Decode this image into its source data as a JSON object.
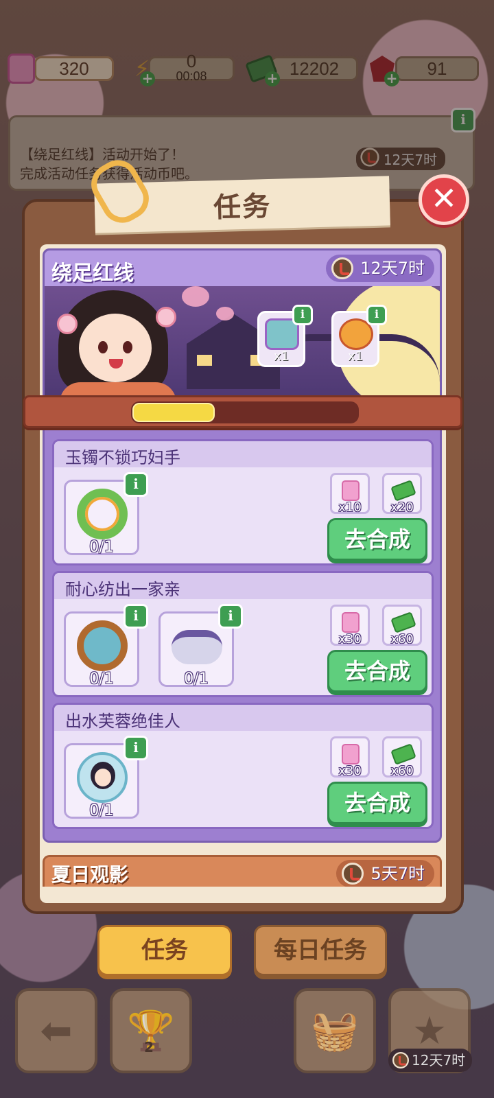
{
  "currency": {
    "tickets": "320",
    "energy": "0",
    "energy_timer": "00:08",
    "cash": "12202",
    "gems": "91"
  },
  "notice": {
    "line1": "【绕足红线】活动开始了！",
    "line2": "完成活动任务获得活动币吧。",
    "timer": "12天7时"
  },
  "dialog": {
    "title": "任务",
    "close_icon": "close-icon"
  },
  "event": {
    "name": "绕足红线",
    "timer": "12天7时",
    "rewards": [
      {
        "label": "x1",
        "icon": "chest-icon"
      },
      {
        "label": "x1",
        "icon": "heart-ornament-icon"
      }
    ],
    "progress": 0.36
  },
  "tasks": [
    {
      "title": "玉镯不锁巧妇手",
      "items": [
        {
          "count": "0/1",
          "icon": "jade-bracelet-icon"
        }
      ],
      "rewards": [
        {
          "label": "x10",
          "icon": "ticket-icon"
        },
        {
          "label": "x20",
          "icon": "cash-icon"
        }
      ],
      "action": "去合成"
    },
    {
      "title": "耐心纺出一家亲",
      "items": [
        {
          "count": "0/1",
          "icon": "spinning-wheel-icon"
        },
        {
          "count": "0/1",
          "icon": "magpie-cloud-icon"
        }
      ],
      "rewards": [
        {
          "label": "x30",
          "icon": "ticket-icon"
        },
        {
          "label": "x60",
          "icon": "cash-icon"
        }
      ],
      "action": "去合成"
    },
    {
      "title": "出水芙蓉绝佳人",
      "items": [
        {
          "count": "0/1",
          "icon": "lotus-maiden-icon"
        }
      ],
      "rewards": [
        {
          "label": "x30",
          "icon": "ticket-icon"
        },
        {
          "label": "x60",
          "icon": "cash-icon"
        }
      ],
      "action": "去合成"
    }
  ],
  "next_event": {
    "name": "夏日观影",
    "timer": "5天7时"
  },
  "tabs": {
    "tasks": "任务",
    "daily": "每日任务"
  },
  "bottom_nav": {
    "trophy_badge": "2",
    "timer": "12天7时"
  },
  "colors": {
    "event_purple": "#9d7fd0",
    "go_button": "#5fce7d",
    "tab_active": "#f7c24c",
    "close_red": "#e2434a"
  }
}
